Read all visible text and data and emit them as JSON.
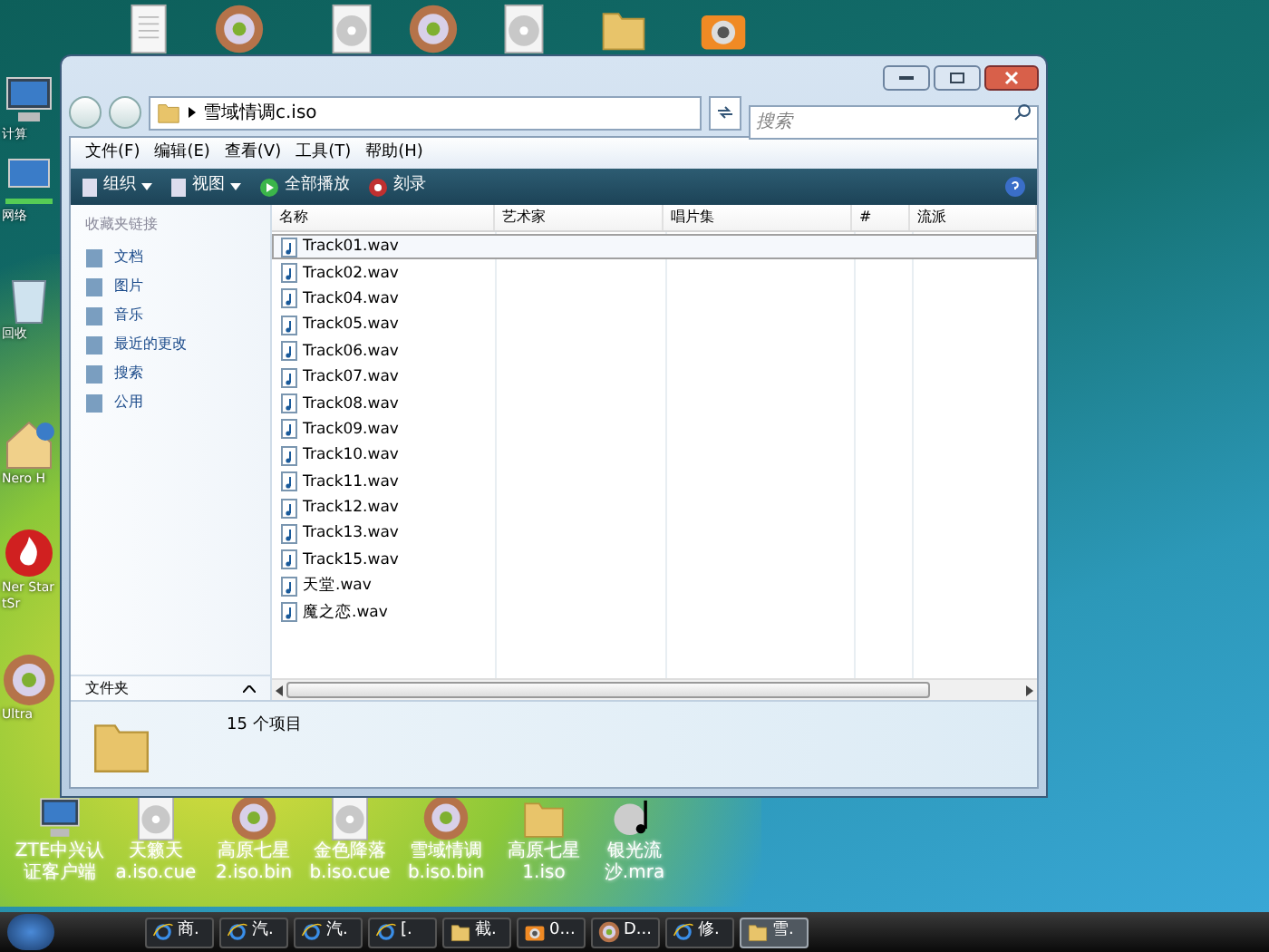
{
  "desktop": {
    "top_icons": [
      {
        "kind": "file"
      },
      {
        "kind": "disc"
      },
      {
        "kind": "cd"
      },
      {
        "kind": "disc"
      },
      {
        "kind": "cd"
      },
      {
        "kind": "folder"
      },
      {
        "kind": "camera"
      }
    ],
    "left_icons": [
      {
        "kind": "computer",
        "label": "计算"
      },
      {
        "kind": "network",
        "label": "网络"
      },
      {
        "kind": "bin",
        "label": "回收"
      },
      {
        "kind": "house",
        "label": "Nero H"
      },
      {
        "kind": "flame",
        "label": "Ner StartSr"
      },
      {
        "kind": "disc",
        "label": "Ultra"
      }
    ],
    "bottom_icons": [
      {
        "kind": "computer",
        "label": "ZTE中兴认证客户端"
      },
      {
        "kind": "cd",
        "label": "天籁天 a.iso.cue"
      },
      {
        "kind": "disc",
        "label": "高原七星 2.iso.bin"
      },
      {
        "kind": "cd",
        "label": "金色降落 b.iso.cue"
      },
      {
        "kind": "disc",
        "label": "雪域情调 b.iso.bin"
      },
      {
        "kind": "folder",
        "label": "高原七星 1.iso"
      },
      {
        "kind": "music",
        "label": "银光流沙.mra"
      }
    ]
  },
  "window": {
    "address": "雪域情调c.iso",
    "search": {
      "placeholder": "搜索"
    },
    "menu": [
      "文件(F)",
      "编辑(E)",
      "查看(V)",
      "工具(T)",
      "帮助(H)"
    ],
    "toolbar": [
      {
        "label": "组织",
        "kind": "menu"
      },
      {
        "label": "视图",
        "kind": "menu"
      },
      {
        "label": "全部播放",
        "kind": "play"
      },
      {
        "label": "刻录",
        "kind": "burn"
      }
    ],
    "sidebar": {
      "heading": "收藏夹链接",
      "items": [
        "文档",
        "图片",
        "音乐",
        "最近的更改",
        "搜索",
        "公用"
      ],
      "folders": "文件夹"
    },
    "table": {
      "columns": [
        "名称",
        "艺术家",
        "唱片集",
        "#",
        "流派"
      ],
      "rows": [
        {
          "name": "Track01.wav",
          "selected": true
        },
        {
          "name": "Track02.wav",
          "selected": false
        },
        {
          "name": "Track04.wav",
          "selected": false
        },
        {
          "name": "Track05.wav",
          "selected": false
        },
        {
          "name": "Track06.wav",
          "selected": false
        },
        {
          "name": "Track07.wav",
          "selected": false
        },
        {
          "name": "Track08.wav",
          "selected": false
        },
        {
          "name": "Track09.wav",
          "selected": false
        },
        {
          "name": "Track10.wav",
          "selected": false
        },
        {
          "name": "Track11.wav",
          "selected": false
        },
        {
          "name": "Track12.wav",
          "selected": false
        },
        {
          "name": "Track13.wav",
          "selected": false
        },
        {
          "name": "Track15.wav",
          "selected": false
        },
        {
          "name": "天堂.wav",
          "selected": false
        },
        {
          "name": "魔之恋.wav",
          "selected": false
        }
      ]
    },
    "status": "15 个项目"
  },
  "taskbar": {
    "items": [
      {
        "label": "商.",
        "kind": "ie",
        "selected": false
      },
      {
        "label": "汽.",
        "kind": "ie",
        "selected": false
      },
      {
        "label": "汽.",
        "kind": "ie",
        "selected": false
      },
      {
        "label": "[.",
        "kind": "ie",
        "selected": false
      },
      {
        "label": "截.",
        "kind": "folder",
        "selected": false
      },
      {
        "label": "0...",
        "kind": "camera",
        "selected": false
      },
      {
        "label": "D...",
        "kind": "disc",
        "selected": false
      },
      {
        "label": "修.",
        "kind": "ie",
        "selected": false
      },
      {
        "label": "雪.",
        "kind": "folder",
        "selected": true
      }
    ]
  }
}
